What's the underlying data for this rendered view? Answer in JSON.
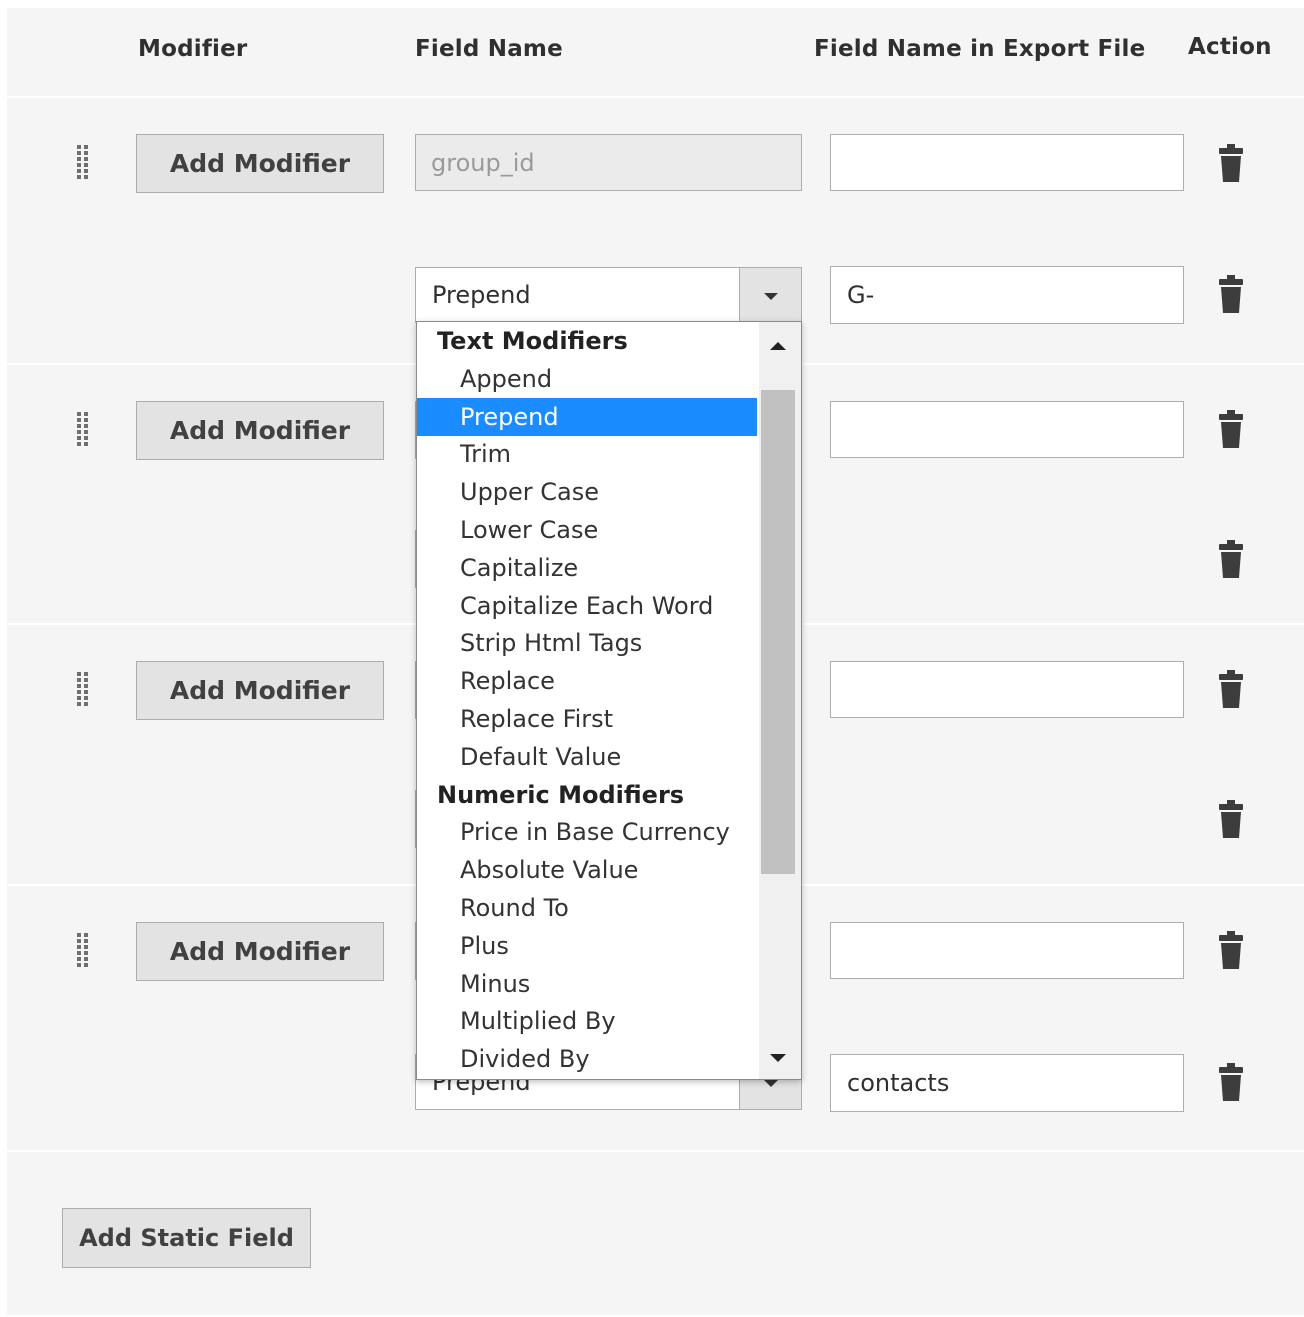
{
  "headers": {
    "modifier": "Modifier",
    "field_name": "Field Name",
    "export_name": "Field Name in Export File",
    "action": "Action"
  },
  "buttons": {
    "add_modifier": "Add Modifier",
    "add_static_field": "Add Static Field"
  },
  "rows": [
    {
      "field_value": "group_id",
      "export_value": ""
    },
    {
      "modifier_value": "Prepend",
      "export_value": "G-"
    },
    {
      "export_value": ""
    },
    {
      "export_value": ""
    },
    {
      "export_value": ""
    },
    {
      "modifier_value": "Prepend",
      "export_value": "contacts"
    }
  ],
  "dropdown": {
    "selected": "Prepend",
    "groups": [
      {
        "label": "Text Modifiers",
        "options": [
          "Append",
          "Prepend",
          "Trim",
          "Upper Case",
          "Lower Case",
          "Capitalize",
          "Capitalize Each Word",
          "Strip Html Tags",
          "Replace",
          "Replace First",
          "Default Value"
        ]
      },
      {
        "label": "Numeric Modifiers",
        "options": [
          "Price in Base Currency",
          "Absolute Value",
          "Round To",
          "Plus",
          "Minus",
          "Multiplied By",
          "Divided By"
        ]
      }
    ]
  },
  "icons": {
    "drag_handle": "grip-dots-icon",
    "delete": "trash-icon",
    "select_arrow": "caret-down-icon"
  },
  "colors": {
    "selected_option": "#1a8cff",
    "panel_bg": "#f5f5f5",
    "button_bg": "#e3e3e3"
  }
}
